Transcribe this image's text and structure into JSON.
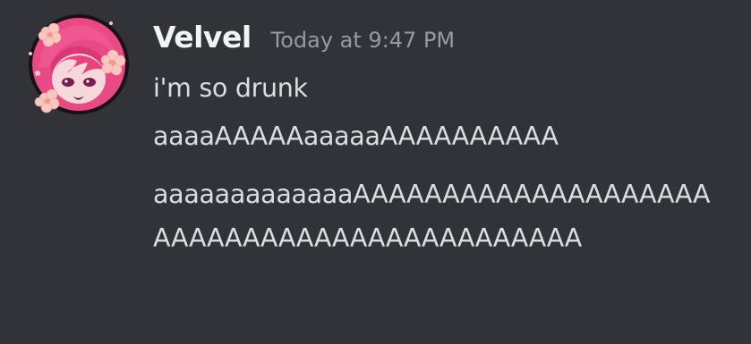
{
  "message": {
    "username": "Velvel",
    "timestamp": "Today at 9:47 PM",
    "lines": [
      "i'm so drunk",
      "aaaaAAAAAaaaaaAAAAAAAAAA",
      "aaaaaaaaaaaaaAAAAAAAAAAAAAAAAAAAAAAAAAAAAAAAAAAAAAAAAAAAA"
    ]
  },
  "colors": {
    "background": "#313338",
    "username": "#f2f3f5",
    "timestamp": "#949ba4",
    "text": "#dbdee1",
    "avatar_accent": "#e4407f"
  }
}
